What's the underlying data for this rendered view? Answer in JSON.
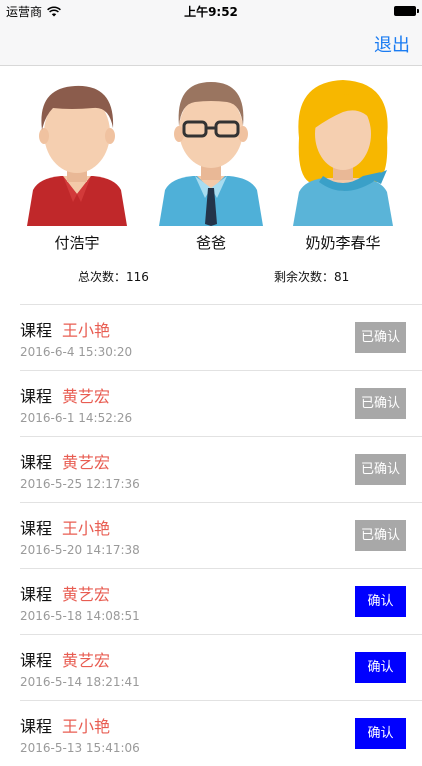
{
  "status_bar": {
    "carrier": "运营商",
    "time": "上午9:52"
  },
  "nav": {
    "logout_label": "退出"
  },
  "profiles": [
    {
      "name": "付浩宇",
      "icon": "boy-avatar-icon"
    },
    {
      "name": "爸爸",
      "icon": "father-avatar-icon"
    },
    {
      "name": "奶奶李春华",
      "icon": "grandmother-avatar-icon"
    }
  ],
  "stats": {
    "total_label": "总次数：",
    "total_value": "116",
    "remaining_label": "剩余次数：",
    "remaining_value": "81"
  },
  "records": [
    {
      "label": "课程",
      "teacher": "王小艳",
      "time": "2016-6-4 15:30:20",
      "status": "已确认",
      "confirmed": true
    },
    {
      "label": "课程",
      "teacher": "黄艺宏",
      "time": "2016-6-1 14:52:26",
      "status": "已确认",
      "confirmed": true
    },
    {
      "label": "课程",
      "teacher": "黄艺宏",
      "time": "2016-5-25 12:17:36",
      "status": "已确认",
      "confirmed": true
    },
    {
      "label": "课程",
      "teacher": "王小艳",
      "time": "2016-5-20 14:17:38",
      "status": "已确认",
      "confirmed": true
    },
    {
      "label": "课程",
      "teacher": "黄艺宏",
      "time": "2016-5-18 14:08:51",
      "status": "确认",
      "confirmed": false
    },
    {
      "label": "课程",
      "teacher": "黄艺宏",
      "time": "2016-5-14 18:21:41",
      "status": "确认",
      "confirmed": false
    },
    {
      "label": "课程",
      "teacher": "王小艳",
      "time": "2016-5-13 15:41:06",
      "status": "确认",
      "confirmed": false
    }
  ],
  "colors": {
    "accent": "#1b7cf2",
    "teacher_name": "#e85d52",
    "confirmed_button": "#a8a8a8",
    "confirm_button": "#0000ff"
  }
}
